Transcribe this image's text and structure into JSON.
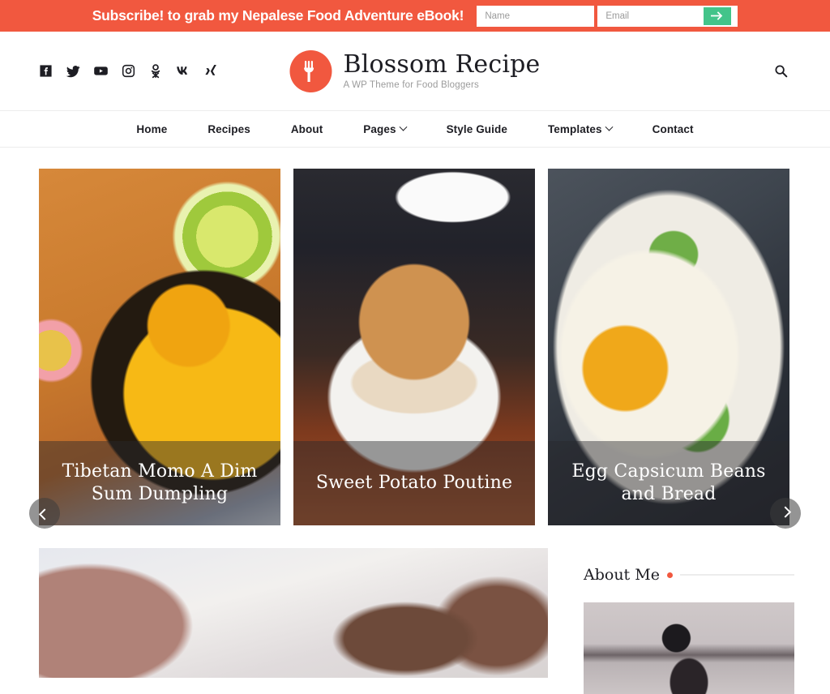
{
  "subscribe": {
    "message": "Subscribe! to grab my Nepalese Food Adventure eBook!",
    "name_placeholder": "Name",
    "email_placeholder": "Email",
    "name_value": "",
    "email_value": "",
    "submit_icon": "arrow-right-icon",
    "bar_color": "#f1583f",
    "submit_color": "#43c48a"
  },
  "header": {
    "brand_title": "Blossom Recipe",
    "brand_tagline": "A WP Theme for Food Bloggers",
    "brand_mark_icon": "fork-icon",
    "brand_mark_color": "#f1583f",
    "search_icon": "search-icon",
    "social": [
      {
        "name": "facebook",
        "label": "Facebook"
      },
      {
        "name": "twitter",
        "label": "Twitter"
      },
      {
        "name": "youtube",
        "label": "YouTube"
      },
      {
        "name": "instagram",
        "label": "Instagram"
      },
      {
        "name": "odnoklassniki",
        "label": "Odnoklassniki"
      },
      {
        "name": "vk",
        "label": "VK"
      },
      {
        "name": "xing",
        "label": "Xing"
      }
    ]
  },
  "nav": {
    "items": [
      {
        "label": "Home",
        "has_dropdown": false
      },
      {
        "label": "Recipes",
        "has_dropdown": false
      },
      {
        "label": "About",
        "has_dropdown": false
      },
      {
        "label": "Pages",
        "has_dropdown": true
      },
      {
        "label": "Style Guide",
        "has_dropdown": false
      },
      {
        "label": "Templates",
        "has_dropdown": true
      },
      {
        "label": "Contact",
        "has_dropdown": false
      }
    ]
  },
  "slider": {
    "prev_icon": "chevron-left-icon",
    "next_icon": "chevron-right-icon",
    "slides": [
      {
        "title": "Tibetan Momo A Dim Sum Dumpling",
        "image_alt": "passion-fruit-juice-with-lime",
        "art": "img-juice"
      },
      {
        "title": "Sweet Potato Poutine",
        "image_alt": "sesame-bun-burger-in-takeout-box",
        "art": "img-burger"
      },
      {
        "title": "Egg Capsicum Beans and Bread",
        "image_alt": "fried-egg-bowl-with-scallions",
        "art": "img-egg"
      }
    ]
  },
  "main": {
    "post_image_alt": "blurred-dried-flowers-on-table",
    "post_art": "img-blur"
  },
  "sidebar": {
    "about_title": "About Me",
    "about_image_alt": "person-in-kitchen",
    "about_art": "img-kitchen",
    "accent_color": "#f1583f"
  }
}
